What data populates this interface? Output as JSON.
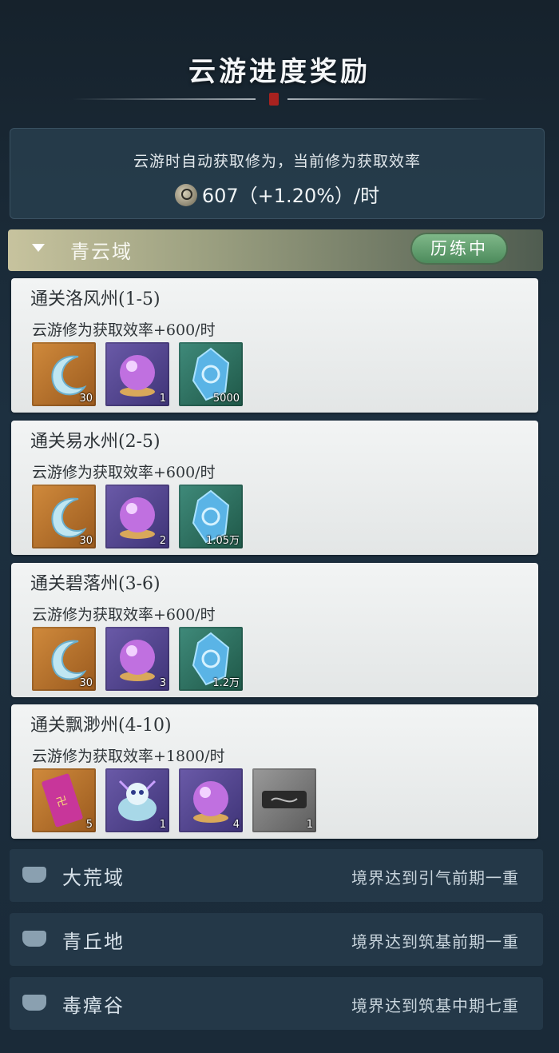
{
  "header": {
    "title": "云游进度奖励"
  },
  "info": {
    "description": "云游时自动获取修为，当前修为获取效率",
    "rate_text": "607（+1.20%）/时"
  },
  "active_region": {
    "name": "青云域",
    "status": "历练中"
  },
  "stages": [
    {
      "title": "通关洛风州(1-5)",
      "rate": "云游修为获取效率+600/时",
      "items": [
        {
          "icon": "crescent-moon-icon",
          "count": "30"
        },
        {
          "icon": "purple-orb-icon",
          "count": "1"
        },
        {
          "icon": "spirit-stone-icon",
          "count": "5000"
        }
      ]
    },
    {
      "title": "通关易水州(2-5)",
      "rate": "云游修为获取效率+600/时",
      "items": [
        {
          "icon": "crescent-moon-icon",
          "count": "30"
        },
        {
          "icon": "purple-orb-icon",
          "count": "2"
        },
        {
          "icon": "spirit-stone-icon",
          "count": "1.05万"
        }
      ]
    },
    {
      "title": "通关碧落州(3-6)",
      "rate": "云游修为获取效率+600/时",
      "items": [
        {
          "icon": "crescent-moon-icon",
          "count": "30"
        },
        {
          "icon": "purple-orb-icon",
          "count": "3"
        },
        {
          "icon": "spirit-stone-icon",
          "count": "1.2万"
        }
      ]
    },
    {
      "title": "通关飘渺州(4-10)",
      "rate": "云游修为获取效率+1800/时",
      "items": [
        {
          "icon": "talisman-icon",
          "count": "5"
        },
        {
          "icon": "spirit-beast-icon",
          "count": "1"
        },
        {
          "icon": "purple-orb-icon",
          "count": "4"
        },
        {
          "icon": "dark-scroll-icon",
          "count": "1"
        }
      ]
    }
  ],
  "locked_regions": [
    {
      "name": "大荒域",
      "requirement": "境界达到引气前期一重"
    },
    {
      "name": "青丘地",
      "requirement": "境界达到筑基前期一重"
    },
    {
      "name": "毒瘴谷",
      "requirement": "境界达到筑基中期七重"
    }
  ]
}
